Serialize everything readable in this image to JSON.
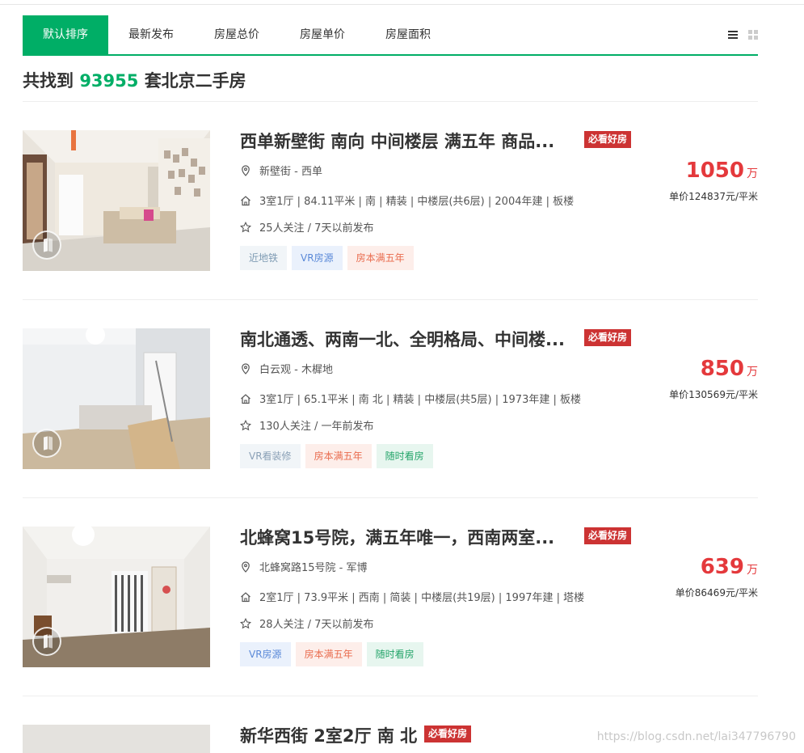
{
  "tabs": [
    "默认排序",
    "最新发布",
    "房屋总价",
    "房屋单价",
    "房屋面积"
  ],
  "result": {
    "prefix": "共找到",
    "count": "93955",
    "suffix": "套北京二手房"
  },
  "listings": [
    {
      "title": "西单新壁街 南向 中间楼层 满五年 商品...",
      "badge": "必看好房",
      "location": "新壁街 - 西单",
      "house_info": "3室1厅 | 84.11平米 | 南 | 精装 | 中楼层(共6层) | 2004年建 | 板楼",
      "follow_info": "25人关注 / 7天以前发布",
      "tags": [
        "近地铁",
        "VR房源",
        "房本满五年"
      ],
      "total_price": "1050",
      "price_unit": "万",
      "unit_price": "单价124837元/平米"
    },
    {
      "title": "南北通透、两南一北、全明格局、中间楼...",
      "badge": "必看好房",
      "location": "白云观 - 木樨地",
      "house_info": "3室1厅 | 65.1平米 | 南 北 | 精装 | 中楼层(共5层) | 1973年建 | 板楼",
      "follow_info": "130人关注 / 一年前发布",
      "tags": [
        "VR看装修",
        "房本满五年",
        "随时看房"
      ],
      "total_price": "850",
      "price_unit": "万",
      "unit_price": "单价130569元/平米"
    },
    {
      "title": "北蜂窝15号院，满五年唯一，西南两室...",
      "badge": "必看好房",
      "location": "北蜂窝路15号院 - 军博",
      "house_info": "2室1厅 | 73.9平米 | 西南 | 简装 | 中楼层(共19层) | 1997年建 | 塔楼",
      "follow_info": "28人关注 / 7天以前发布",
      "tags": [
        "VR房源",
        "房本满五年",
        "随时看房"
      ],
      "total_price": "639",
      "price_unit": "万",
      "unit_price": "单价86469元/平米"
    },
    {
      "title": "新华西街 2室2厅 南 北",
      "badge": "必看好房"
    }
  ],
  "watermark": "https://blog.csdn.net/lai347796790",
  "colors": {
    "brand": "#00ae66",
    "price": "#e4393c",
    "badge": "#cc3333"
  }
}
